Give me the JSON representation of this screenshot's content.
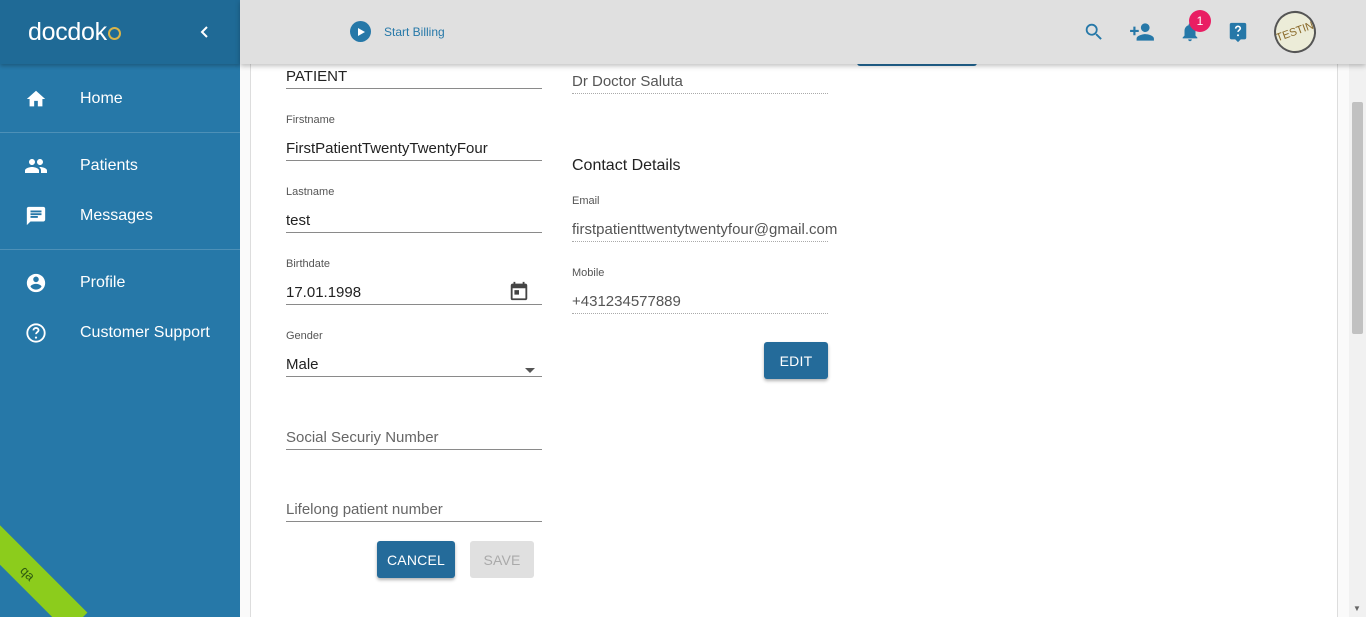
{
  "sidebar": {
    "logo": "docdok",
    "items": [
      {
        "label": "Home",
        "icon": "home-icon"
      },
      {
        "label": "Patients",
        "icon": "people-icon"
      },
      {
        "label": "Messages",
        "icon": "message-icon"
      },
      {
        "label": "Profile",
        "icon": "account-circle-icon"
      },
      {
        "label": "Customer Support",
        "icon": "help-circle-icon"
      }
    ],
    "env_ribbon": "qa"
  },
  "topbar": {
    "billing_label": "Start Billing",
    "notification_count": "1",
    "avatar_text": "TESTIN"
  },
  "form": {
    "role_value": "PATIENT",
    "firstname_label": "Firstname",
    "firstname_value": "FirstPatientTwentyTwentyFour",
    "lastname_label": "Lastname",
    "lastname_value": "test",
    "birthdate_label": "Birthdate",
    "birthdate_value": "17.01.1998",
    "gender_label": "Gender",
    "gender_value": "Male",
    "ssn_placeholder": "Social Securiy Number",
    "lifelong_placeholder": "Lifelong patient number",
    "cancel_label": "CANCEL",
    "save_label": "SAVE"
  },
  "right": {
    "doctor_value": "Dr Doctor Saluta",
    "contact_title": "Contact Details",
    "email_label": "Email",
    "email_value": "firstpatienttwentytwentyfour@gmail.com",
    "mobile_label": "Mobile",
    "mobile_value": "+431234577889",
    "edit_label": "EDIT"
  },
  "colors": {
    "sidebar": "#2678a8",
    "primary": "#246b9a",
    "badge": "#e91e63",
    "ribbon": "#8ccc1c"
  }
}
